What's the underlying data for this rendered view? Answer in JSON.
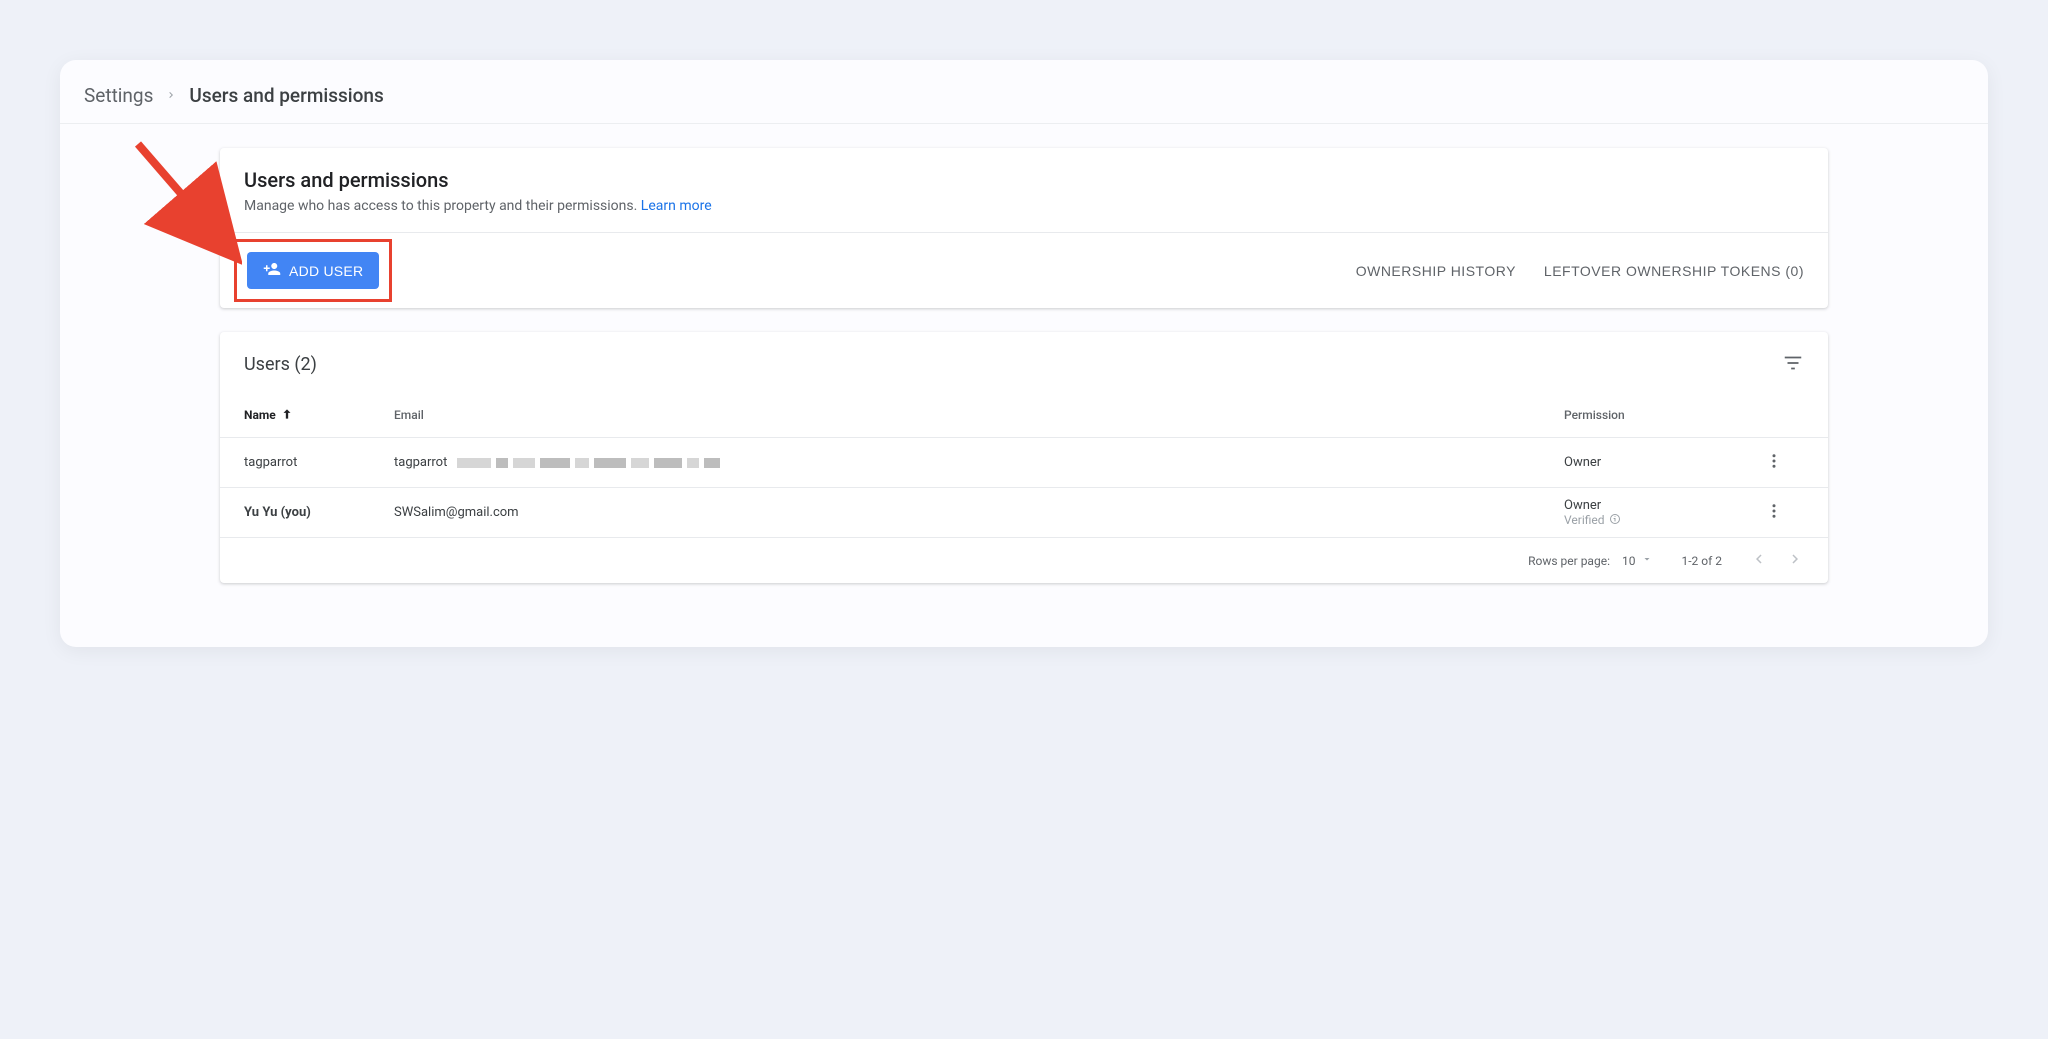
{
  "breadcrumb": {
    "root": "Settings",
    "current": "Users and permissions"
  },
  "header": {
    "title": "Users and permissions",
    "subtitle": "Manage who has access to this property and their permissions. ",
    "learn_more": "Learn more"
  },
  "actions": {
    "add_user": "ADD USER",
    "ownership_history": "OWNERSHIP HISTORY",
    "leftover_tokens": "LEFTOVER OWNERSHIP TOKENS (0)"
  },
  "list": {
    "title": "Users (2)",
    "columns": {
      "name": "Name",
      "email": "Email",
      "permission": "Permission"
    },
    "rows": [
      {
        "name": "tagparrot",
        "name_bold": false,
        "email_prefix": "tagparrot",
        "email_blurred": true,
        "email": "",
        "permission": "Owner",
        "verified": false
      },
      {
        "name": "Yu Yu (you)",
        "name_bold": true,
        "email": "SWSalim@gmail.com",
        "email_blurred": false,
        "permission": "Owner",
        "verified": true,
        "verified_label": "Verified"
      }
    ]
  },
  "footer": {
    "rows_per_page_label": "Rows per page:",
    "rows_per_page_value": "10",
    "range": "1-2 of 2"
  }
}
